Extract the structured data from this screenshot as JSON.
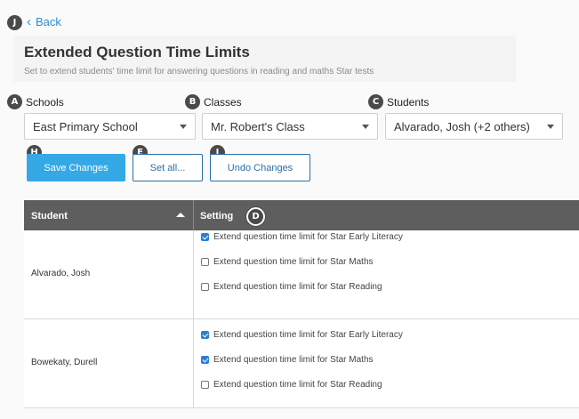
{
  "header": {
    "back_label": "Back",
    "title": "Extended Question Time Limits",
    "subtitle": "Set to extend students' time limit for answering questions in reading and maths Star tests"
  },
  "filters": {
    "schools_label": "Schools",
    "schools_value": "East Primary School",
    "classes_label": "Classes",
    "classes_value": "Mr. Robert's Class",
    "students_label": "Students",
    "students_value": "Alvarado, Josh (+2 others)"
  },
  "actions": {
    "save_label": "Save Changes",
    "set_all_label": "Set all...",
    "undo_label": "Undo Changes"
  },
  "badges": {
    "A": "A",
    "B": "B",
    "C": "C",
    "D": "D",
    "E": "E",
    "H": "H",
    "I": "I",
    "J": "J"
  },
  "table": {
    "col_student": "Student",
    "col_setting": "Setting",
    "rows": [
      {
        "name": "Alvarado, Josh",
        "options": [
          {
            "label": "Extend question time limit for Star Early Literacy",
            "checked": true
          },
          {
            "label": "Extend question time limit for Star Maths",
            "checked": false
          },
          {
            "label": "Extend question time limit for Star Reading",
            "checked": false
          }
        ]
      },
      {
        "name": "Bowekaty, Durell",
        "options": [
          {
            "label": "Extend question time limit for Star Early Literacy",
            "checked": true
          },
          {
            "label": "Extend question time limit for Star Maths",
            "checked": true
          },
          {
            "label": "Extend question time limit for Star Reading",
            "checked": false
          }
        ]
      }
    ]
  }
}
